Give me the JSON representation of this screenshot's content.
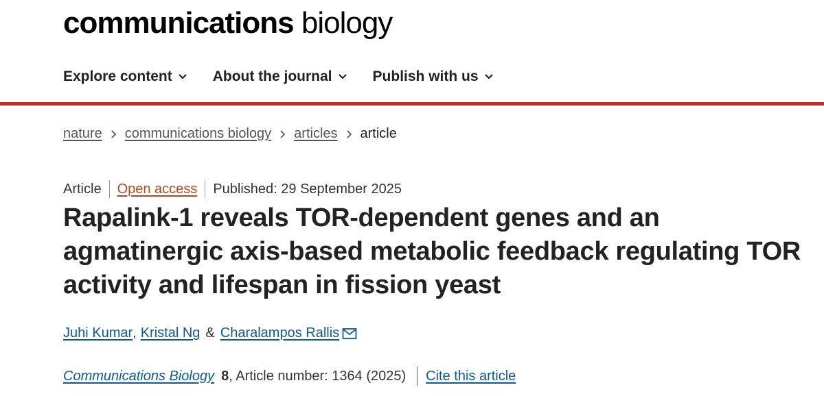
{
  "brand": {
    "bold": "communications",
    "light": "biology"
  },
  "nav": [
    {
      "label": "Explore content"
    },
    {
      "label": "About the journal"
    },
    {
      "label": "Publish with us"
    }
  ],
  "breadcrumbs": {
    "items": [
      "nature",
      "communications biology",
      "articles"
    ],
    "current": "article"
  },
  "meta": {
    "type": "Article",
    "access": "Open access",
    "published": "Published: 29 September 2025"
  },
  "title": "Rapalink-1 reveals TOR-dependent genes and an agmatinergic axis-based metabolic feedback regulating TOR activity and lifespan in fission yeast",
  "authors": {
    "a1": "Juhi Kumar",
    "sep1": ",",
    "a2": "Kristal Ng",
    "sep2": "&",
    "a3": "Charalampos Rallis"
  },
  "citation": {
    "journal": "Communications Biology",
    "volume": "8",
    "article_number": ", Article number: 1364 (2025)",
    "cite_label": "Cite this article"
  },
  "colors": {
    "accent_red": "#e0201f",
    "link_blue": "#0a5a9c",
    "open_access_orange": "#c2461a"
  }
}
